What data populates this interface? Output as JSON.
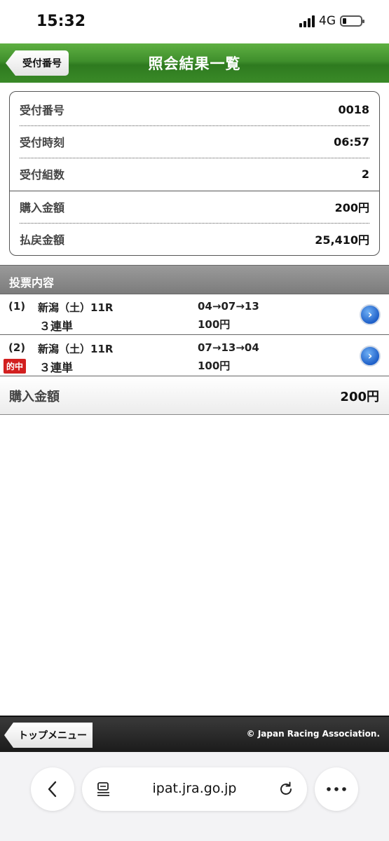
{
  "status": {
    "time": "15:32",
    "network": "4G"
  },
  "header": {
    "back_label": "受付番号",
    "title": "照会結果一覧"
  },
  "summary": {
    "rows": [
      {
        "label": "受付番号",
        "value": "0018"
      },
      {
        "label": "受付時刻",
        "value": "06:57"
      },
      {
        "label": "受付組数",
        "value": "2"
      },
      {
        "label": "購入金額",
        "value": "200円"
      },
      {
        "label": "払戻金額",
        "value": "25,410円"
      }
    ]
  },
  "section": {
    "title": "投票内容"
  },
  "bets": [
    {
      "num": "(1)",
      "race": "新潟（土）11R",
      "type": "３連単",
      "combo": "04→07→13",
      "amount": "100円",
      "hit": ""
    },
    {
      "num": "(2)",
      "race": "新潟（土）11R",
      "type": "３連単",
      "combo": "07→13→04",
      "amount": "100円",
      "hit": "的中"
    }
  ],
  "total": {
    "label": "購入金額",
    "value": "200円"
  },
  "footer": {
    "top_menu_label": "トップメニュー",
    "copyright": "© Japan Racing Association."
  },
  "browser": {
    "url": "ipat.jra.go.jp"
  },
  "colors": {
    "header_green": "#3f8f2c",
    "hit_red": "#d21f1f",
    "go_blue": "#1e5fc8"
  },
  "icons": {
    "back": "chevron-left-icon",
    "reader": "reader-icon",
    "reload": "reload-icon",
    "more": "more-icon",
    "go": "chevron-right-circle-icon"
  }
}
